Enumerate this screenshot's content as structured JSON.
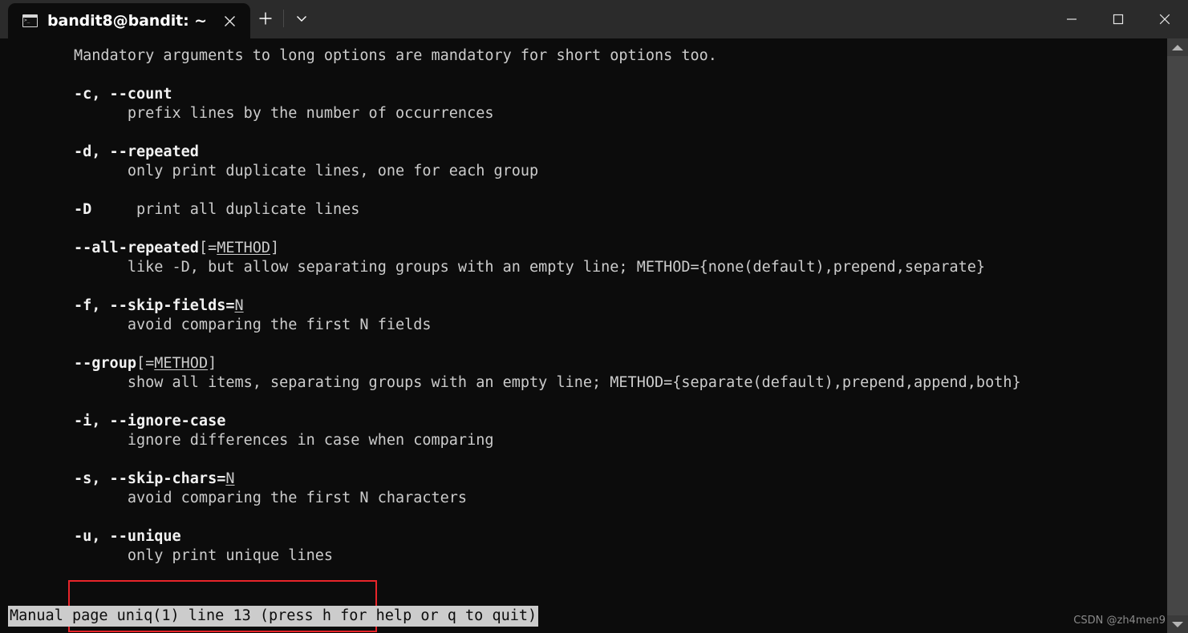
{
  "window": {
    "tab": {
      "title": "bandit8@bandit: ~",
      "icon": "terminal-icon",
      "close_label": "×"
    },
    "new_tab_label": "+",
    "dropdown_label": "⌄",
    "controls": {
      "minimize_label": "—",
      "maximize_label": "☐",
      "close_label": "✕"
    }
  },
  "terminal": {
    "lines": [
      {
        "type": "text",
        "segments": [
          {
            "t": "Mandatory arguments to long options are mandatory for short options too.",
            "s": "plain"
          }
        ]
      },
      {
        "type": "blank",
        "segments": []
      },
      {
        "type": "text",
        "segments": [
          {
            "t": "-c, --count",
            "s": "bold"
          }
        ]
      },
      {
        "type": "text",
        "segments": [
          {
            "t": "      prefix lines by the number of occurrences",
            "s": "plain"
          }
        ]
      },
      {
        "type": "blank",
        "segments": []
      },
      {
        "type": "text",
        "segments": [
          {
            "t": "-d, --repeated",
            "s": "bold"
          }
        ]
      },
      {
        "type": "text",
        "segments": [
          {
            "t": "      only print duplicate lines, one for each group",
            "s": "plain"
          }
        ]
      },
      {
        "type": "blank",
        "segments": []
      },
      {
        "type": "text",
        "segments": [
          {
            "t": "-D",
            "s": "bold"
          },
          {
            "t": "     print all duplicate lines",
            "s": "plain"
          }
        ]
      },
      {
        "type": "blank",
        "segments": []
      },
      {
        "type": "text",
        "segments": [
          {
            "t": "--all-repeated",
            "s": "bold"
          },
          {
            "t": "[=",
            "s": "plain"
          },
          {
            "t": "METHOD",
            "s": "underline"
          },
          {
            "t": "]",
            "s": "plain"
          }
        ]
      },
      {
        "type": "text",
        "segments": [
          {
            "t": "      like -D, but allow separating groups with an empty line; METHOD={none(default),prepend,separate}",
            "s": "plain"
          }
        ]
      },
      {
        "type": "blank",
        "segments": []
      },
      {
        "type": "text",
        "segments": [
          {
            "t": "-f, --skip-fields=",
            "s": "bold"
          },
          {
            "t": "N",
            "s": "underline"
          }
        ]
      },
      {
        "type": "text",
        "segments": [
          {
            "t": "      avoid comparing the first N fields",
            "s": "plain"
          }
        ]
      },
      {
        "type": "blank",
        "segments": []
      },
      {
        "type": "text",
        "segments": [
          {
            "t": "--group",
            "s": "bold"
          },
          {
            "t": "[=",
            "s": "plain"
          },
          {
            "t": "METHOD",
            "s": "underline"
          },
          {
            "t": "]",
            "s": "plain"
          }
        ]
      },
      {
        "type": "text",
        "segments": [
          {
            "t": "      show all items, separating groups with an empty line; METHOD={separate(default),prepend,append,both}",
            "s": "plain"
          }
        ]
      },
      {
        "type": "blank",
        "segments": []
      },
      {
        "type": "text",
        "segments": [
          {
            "t": "-i, --ignore-case",
            "s": "bold"
          }
        ]
      },
      {
        "type": "text",
        "segments": [
          {
            "t": "      ignore differences in case when comparing",
            "s": "plain"
          }
        ]
      },
      {
        "type": "blank",
        "segments": []
      },
      {
        "type": "text",
        "segments": [
          {
            "t": "-s, --skip-chars=",
            "s": "bold"
          },
          {
            "t": "N",
            "s": "underline"
          }
        ]
      },
      {
        "type": "text",
        "segments": [
          {
            "t": "      avoid comparing the first N characters",
            "s": "plain"
          }
        ]
      },
      {
        "type": "blank",
        "segments": []
      },
      {
        "type": "text",
        "segments": [
          {
            "t": "-u, --unique",
            "s": "bold"
          }
        ]
      },
      {
        "type": "text",
        "segments": [
          {
            "t": "      only print unique lines",
            "s": "plain"
          }
        ]
      }
    ],
    "status_line": "Manual page uniq(1) line 13 (press h for help or q to quit)",
    "annotation": {
      "color": "#e8252a",
      "target": "-u, --unique"
    }
  },
  "scrollbar": {
    "up_arrow": "scroll-up-arrow",
    "down_arrow": "scroll-down-arrow"
  },
  "watermark": "CSDN @zh4men9"
}
